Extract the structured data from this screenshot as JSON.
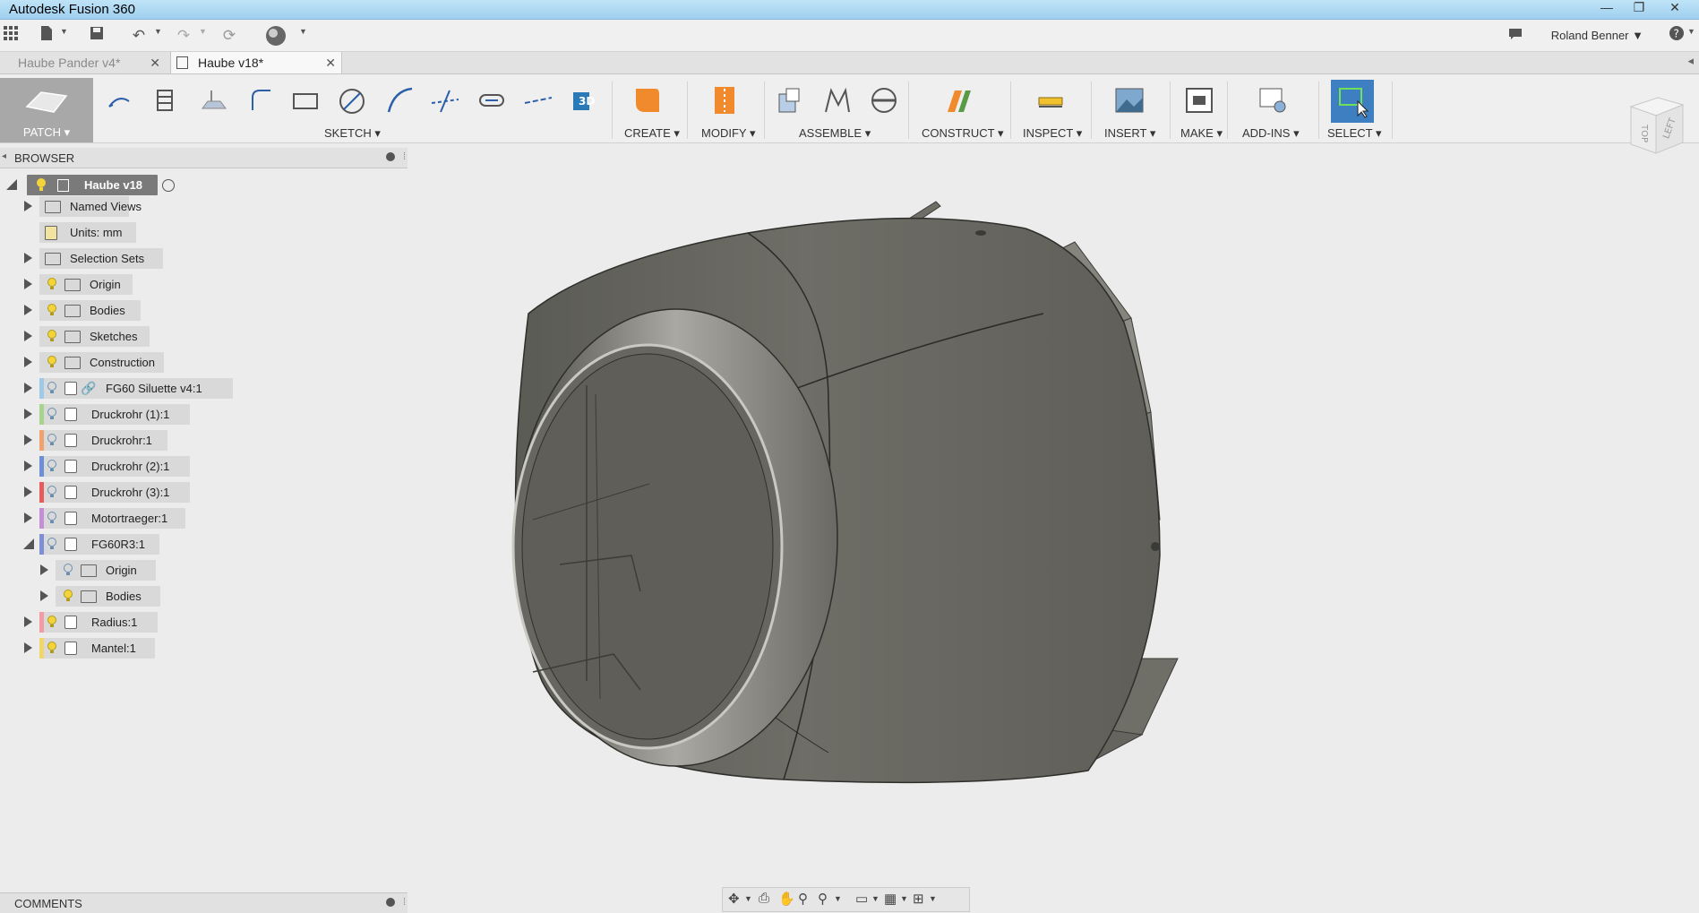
{
  "window": {
    "title": "Autodesk Fusion 360",
    "minimize": "—",
    "restore": "❐",
    "close": "✕"
  },
  "toolbar": {
    "user_name": "Roland Benner",
    "help": "?"
  },
  "tabs": [
    {
      "label": "Haube Pander v4*",
      "active": false
    },
    {
      "label": "Haube v18*",
      "active": true
    }
  ],
  "ribbon": {
    "workspace": "PATCH",
    "groups": [
      "SKETCH",
      "CREATE",
      "MODIFY",
      "ASSEMBLE",
      "CONSTRUCT",
      "INSPECT",
      "INSERT",
      "MAKE",
      "ADD-INS",
      "SELECT"
    ]
  },
  "viewcube": {
    "face_front": "LEFT",
    "face_side": "TOP"
  },
  "browser": {
    "title": "BROWSER",
    "root": "Haube v18",
    "items": [
      {
        "label": "Named Views",
        "type": "folder"
      },
      {
        "label": "Units: mm",
        "type": "doc"
      },
      {
        "label": "Selection Sets",
        "type": "folder"
      },
      {
        "label": "Origin",
        "type": "folder"
      },
      {
        "label": "Bodies",
        "type": "folder"
      },
      {
        "label": "Sketches",
        "type": "folder"
      },
      {
        "label": "Construction",
        "type": "folder"
      },
      {
        "label": "FG60 Siluette v4:1",
        "type": "link",
        "color": "#9fc9e8"
      },
      {
        "label": "Druckrohr (1):1",
        "type": "component",
        "color": "#a7d48b"
      },
      {
        "label": "Druckrohr:1",
        "type": "component",
        "color": "#f0a36f"
      },
      {
        "label": "Druckrohr (2):1",
        "type": "component",
        "color": "#6d8fd8"
      },
      {
        "label": "Druckrohr (3):1",
        "type": "component",
        "color": "#e85b5b"
      },
      {
        "label": "Motortraeger:1",
        "type": "component",
        "color": "#c58fd8"
      },
      {
        "label": "FG60R3:1",
        "type": "component",
        "color": "#7e8fd6"
      },
      {
        "label": "Origin",
        "type": "folder"
      },
      {
        "label": "Bodies",
        "type": "folder"
      },
      {
        "label": "Radius:1",
        "type": "component",
        "color": "#f29aa6"
      },
      {
        "label": "Mantel:1",
        "type": "component",
        "color": "#f2d56b"
      }
    ]
  },
  "comments": {
    "title": "COMMENTS"
  }
}
